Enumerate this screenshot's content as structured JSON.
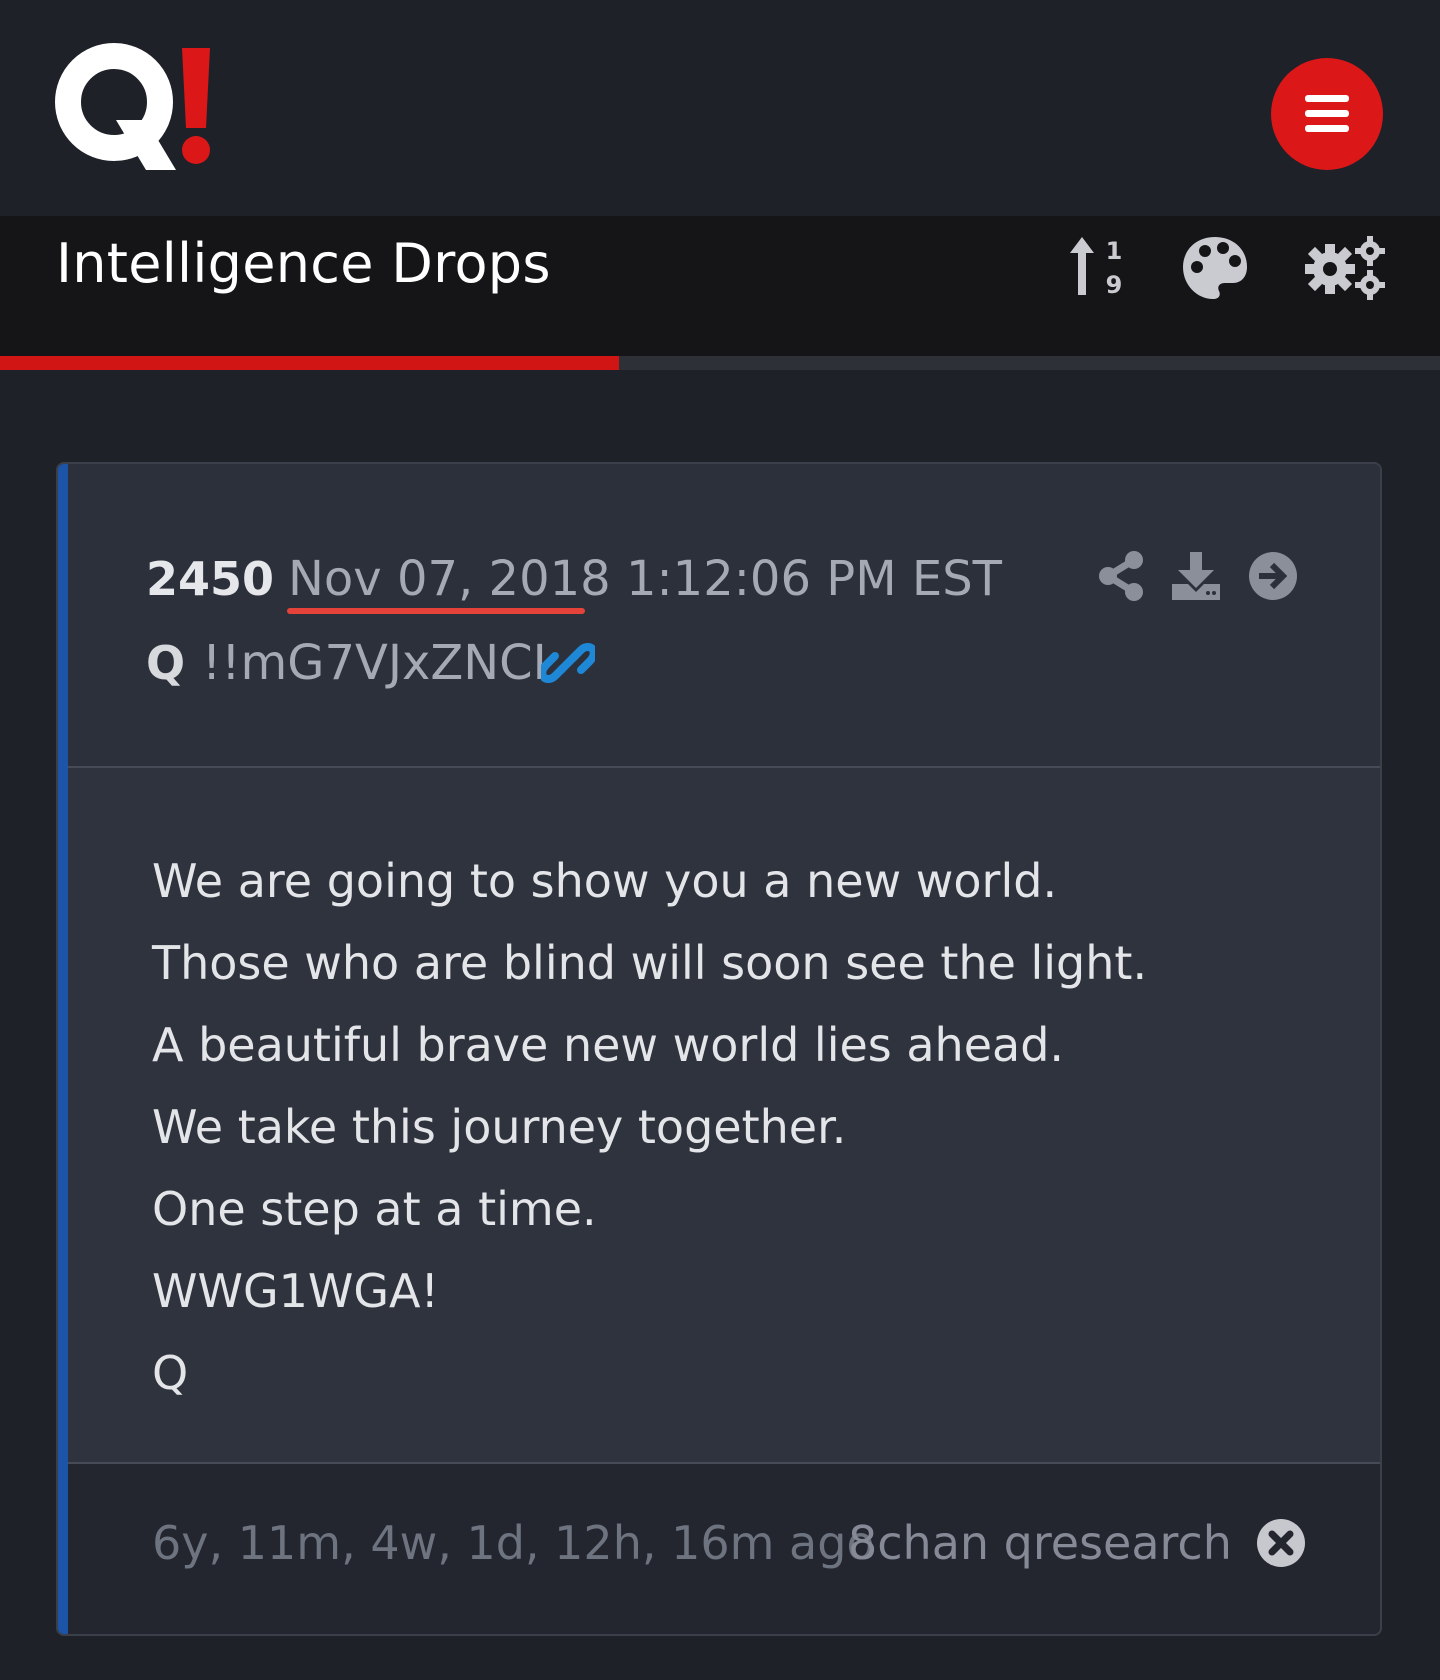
{
  "app": {
    "logo_text": "Q!",
    "menu_icon": "hamburger-icon",
    "accent_color": "#db1717"
  },
  "header": {
    "title": "Intelligence Drops",
    "icons": [
      "sort-numeric-icon",
      "palette-icon",
      "gears-icon"
    ]
  },
  "progress": {
    "fraction": 0.43,
    "fill_color": "#d11414"
  },
  "post": {
    "number": "2450",
    "date": "Nov 07, 2018 1:12:06 PM EST",
    "author": "Q",
    "tripcode": "!!mG7VJxZNCI",
    "head_icons": [
      "share-icon",
      "download-icon",
      "arrow-right-circle-icon",
      "link-icon"
    ],
    "body_lines": [
      "We are going to show you a new world.",
      "Those who are blind will soon see the light.",
      "A beautiful brave new world lies ahead.",
      "We take this journey together.",
      "One step at a time.",
      "WWG1WGA!",
      "Q"
    ],
    "ago": "6y, 11m, 4w, 1d, 12h, 16m ago",
    "source": "8chan qresearch",
    "close_icon": "close-circle-icon",
    "accent_color": "#1c55a8",
    "link_color": "#1e88d6"
  }
}
